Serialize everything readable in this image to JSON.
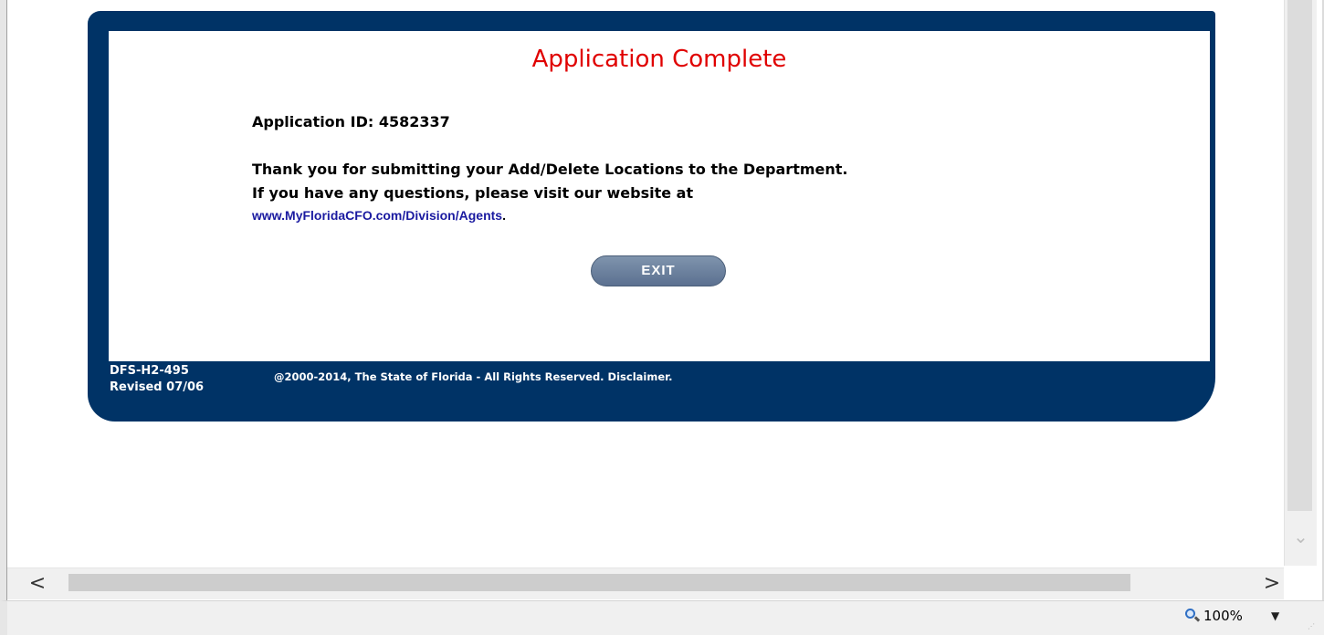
{
  "page": {
    "title": "Application Complete",
    "application_id": "Application ID: 4582337",
    "thanks_text": "Thank you for submitting your Add/Delete Locations to the Department.",
    "visit_text": "If you have any questions, please visit our website at",
    "link_text": "www.MyFloridaCFO.com/Division/Agents",
    "link_suffix": ".",
    "exit_label": "EXIT"
  },
  "footer": {
    "form_code": "DFS-H2-495",
    "revised": "Revised 07/06",
    "copyright": "@2000-2014, The State of Florida - All Rights Reserved. Disclaimer."
  },
  "statusbar": {
    "zoom_level": "100%",
    "zoom_icon": "zoom-magnifier-icon",
    "dropdown_icon": "triangle-down-icon"
  },
  "scrollbars": {
    "left_arrow": "<",
    "right_arrow": ">",
    "down_arrow": "⌄"
  },
  "colors": {
    "panel": "#003366",
    "title": "#e00000",
    "link": "#1a1aa0",
    "button": "#6c819d"
  }
}
